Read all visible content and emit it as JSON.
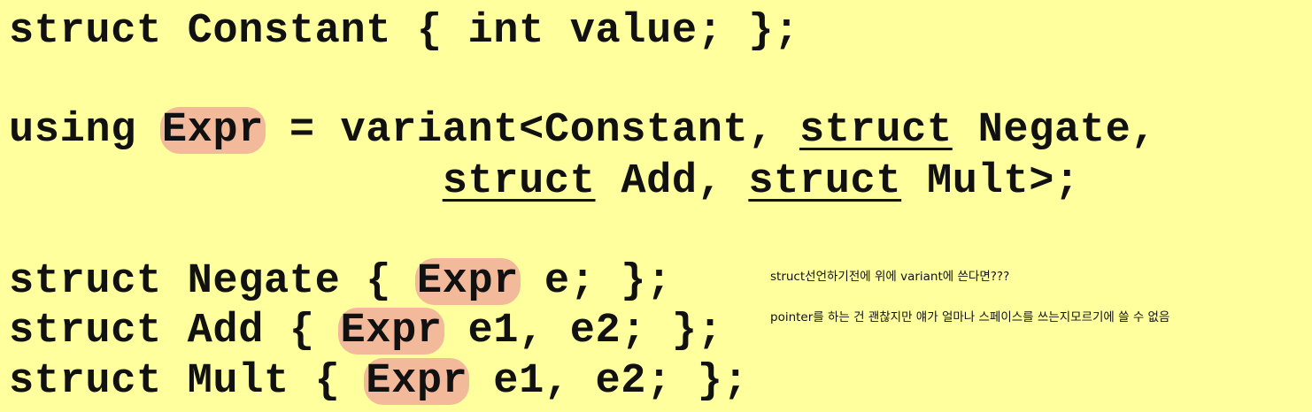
{
  "code": {
    "line1": {
      "text": "struct Constant { int value; };"
    },
    "line2": {
      "pre": "using ",
      "expr": "Expr",
      "mid1": " = variant<Constant, ",
      "kw": "struct",
      "post": " Negate,"
    },
    "line3": {
      "indent": "                 ",
      "kw1": "struct",
      "mid": " Add, ",
      "kw2": "struct",
      "post": " Mult>;"
    },
    "line4": {
      "pre": "struct Negate { ",
      "expr": "Expr",
      "post": " e; };"
    },
    "line5": {
      "pre": "struct Add { ",
      "expr": "Expr",
      "post": " e1, e2; };"
    },
    "line6": {
      "pre": "struct Mult { ",
      "expr": "Expr",
      "post": " e1, e2; };"
    }
  },
  "notes": {
    "note1": "struct선언하기전에 위에 variant에 쓴다면???",
    "note2": "pointer를 하는 건 괜찮지만 얘가 얼마나 스페이스를 쓰는지모르기에 쓸 수 없음"
  },
  "colors": {
    "background": "#ffff9e",
    "highlight": "#f2b99a",
    "text": "#111111"
  }
}
